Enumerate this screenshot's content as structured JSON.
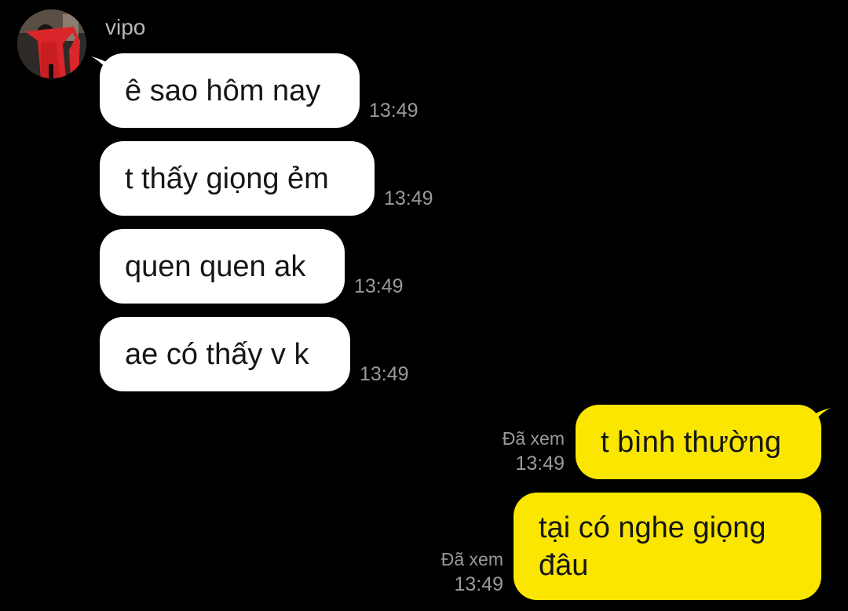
{
  "sender": {
    "name": "vipo"
  },
  "incoming_messages": [
    {
      "text": "ê sao hôm nay",
      "time": "13:49"
    },
    {
      "text": "t thấy giọng ẻm",
      "time": "13:49"
    },
    {
      "text": "quen quen ak",
      "time": "13:49"
    },
    {
      "text": "ae có thấy v k",
      "time": "13:49"
    }
  ],
  "outgoing_messages": [
    {
      "text": "t bình thường",
      "status": "Đã xem",
      "time": "13:49"
    },
    {
      "text": "tại có nghe giọng đâu",
      "status": "Đã xem",
      "time": "13:49"
    }
  ],
  "colors": {
    "background": "#000000",
    "incoming_bubble": "#ffffff",
    "outgoing_bubble": "#fae600",
    "meta_text": "#9a9a9a"
  }
}
